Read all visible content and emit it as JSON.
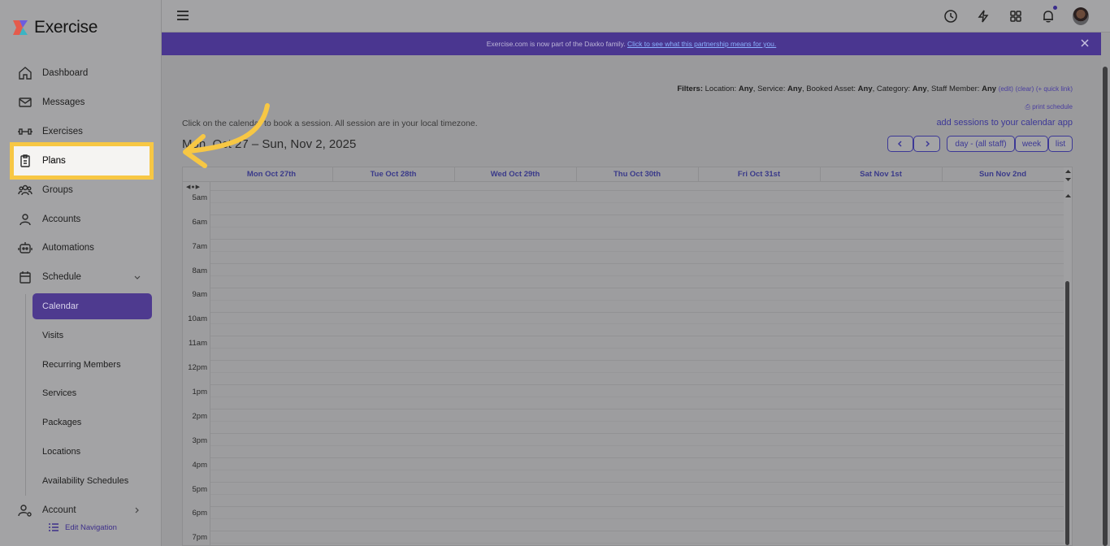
{
  "app": {
    "name": "Exercise"
  },
  "colors": {
    "accent": "#4e3a8f",
    "highlight": "#f7c744",
    "banner": "#4a3690",
    "link": "#3d3897"
  },
  "sidebar": {
    "items": [
      {
        "label": "Dashboard",
        "icon": "home-icon"
      },
      {
        "label": "Messages",
        "icon": "mail-icon"
      },
      {
        "label": "Exercises",
        "icon": "dumbbell-icon"
      },
      {
        "label": "Plans",
        "icon": "clipboard-icon"
      },
      {
        "label": "Groups",
        "icon": "users-icon"
      },
      {
        "label": "Accounts",
        "icon": "user-icon"
      },
      {
        "label": "Automations",
        "icon": "robot-icon"
      },
      {
        "label": "Schedule",
        "icon": "calendar-icon"
      }
    ],
    "schedule_sub": [
      "Calendar",
      "Visits",
      "Recurring Members",
      "Services",
      "Packages",
      "Locations",
      "Availability Schedules"
    ],
    "account_label": "Account",
    "edit_navigation": "Edit Navigation"
  },
  "banner": {
    "text": "Exercise.com is now part of the Daxko family.",
    "link": "Click to see what this partnership means for you."
  },
  "filters": {
    "prefix": "Filters:",
    "location_label": "Location:",
    "location": "Any",
    "service_label": "Service:",
    "service": "Any",
    "asset_label": "Booked Asset:",
    "asset": "Any",
    "category_label": "Category:",
    "category": "Any",
    "staff_label": "Staff Member:",
    "staff": "Any",
    "edit": "(edit)",
    "clear": "(clear)",
    "quick_link": "(+ quick link)",
    "print": "print schedule"
  },
  "main": {
    "hint": "Click on the calendar to book a session. All session are in your local timezone.",
    "add_sessions": "add sessions to your calendar app",
    "date_range": "Mon, Oct 27 – Sun, Nov 2, 2025",
    "btn_day": "day - (all staff)",
    "btn_week": "week",
    "btn_list": "list"
  },
  "calendar": {
    "days": [
      "Mon Oct 27th",
      "Tue Oct 28th",
      "Wed Oct 29th",
      "Thu Oct 30th",
      "Fri Oct 31st",
      "Sat Nov 1st",
      "Sun Nov 2nd"
    ],
    "hours": [
      "5am",
      "6am",
      "7am",
      "8am",
      "9am",
      "10am",
      "11am",
      "12pm",
      "1pm",
      "2pm",
      "3pm",
      "4pm",
      "5pm",
      "6pm",
      "7pm"
    ]
  }
}
